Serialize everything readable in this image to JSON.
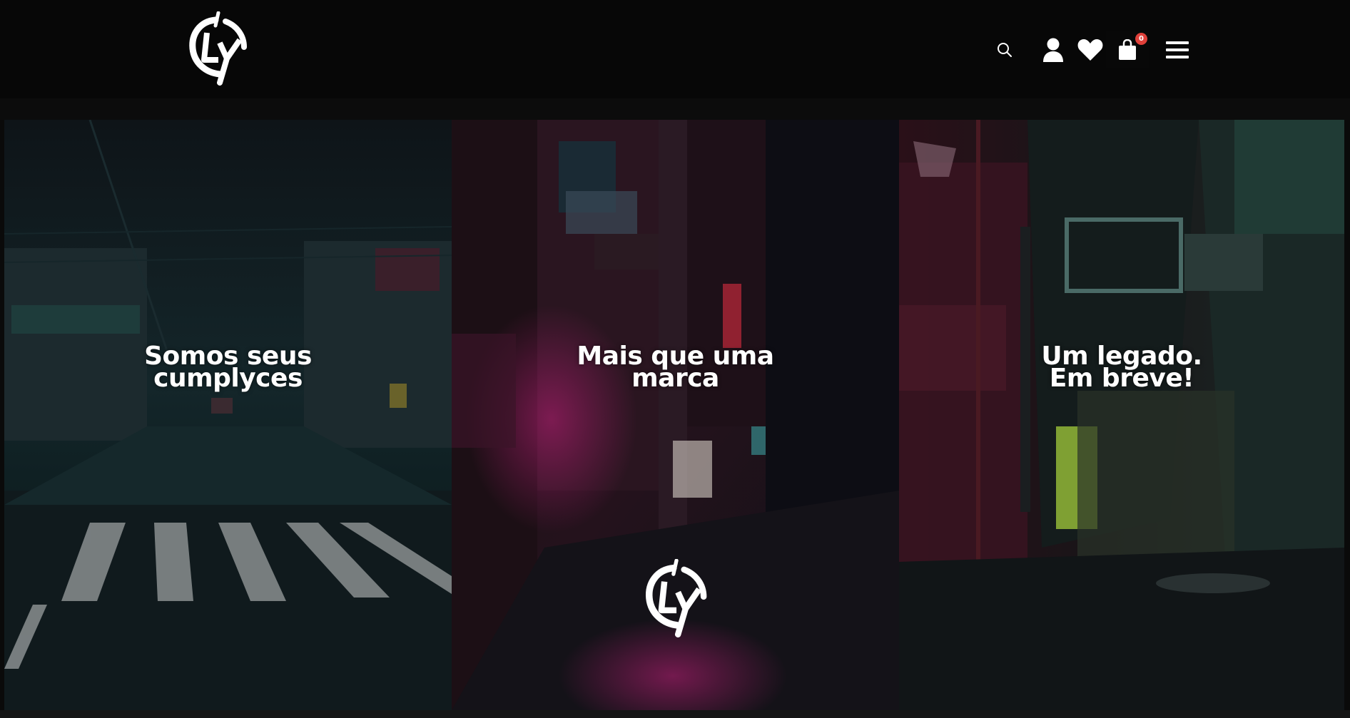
{
  "header": {
    "logo_alt": "LCY",
    "cart_count": "0",
    "icons": [
      "search-icon",
      "user-icon",
      "heart-icon",
      "shopping-bag-icon",
      "menu-icon"
    ]
  },
  "panels": [
    {
      "title": "Somos seus\ncumplyces",
      "tint": "#1d5a5a"
    },
    {
      "title": "Mais que uma\nmarca",
      "tint": "#7a2040"
    },
    {
      "title": "Um legado.\nEm breve!",
      "tint": "#5a1f2a"
    }
  ],
  "colors": {
    "header_bg": "#070707",
    "badge": "#e0403a",
    "text": "#ffffff"
  }
}
